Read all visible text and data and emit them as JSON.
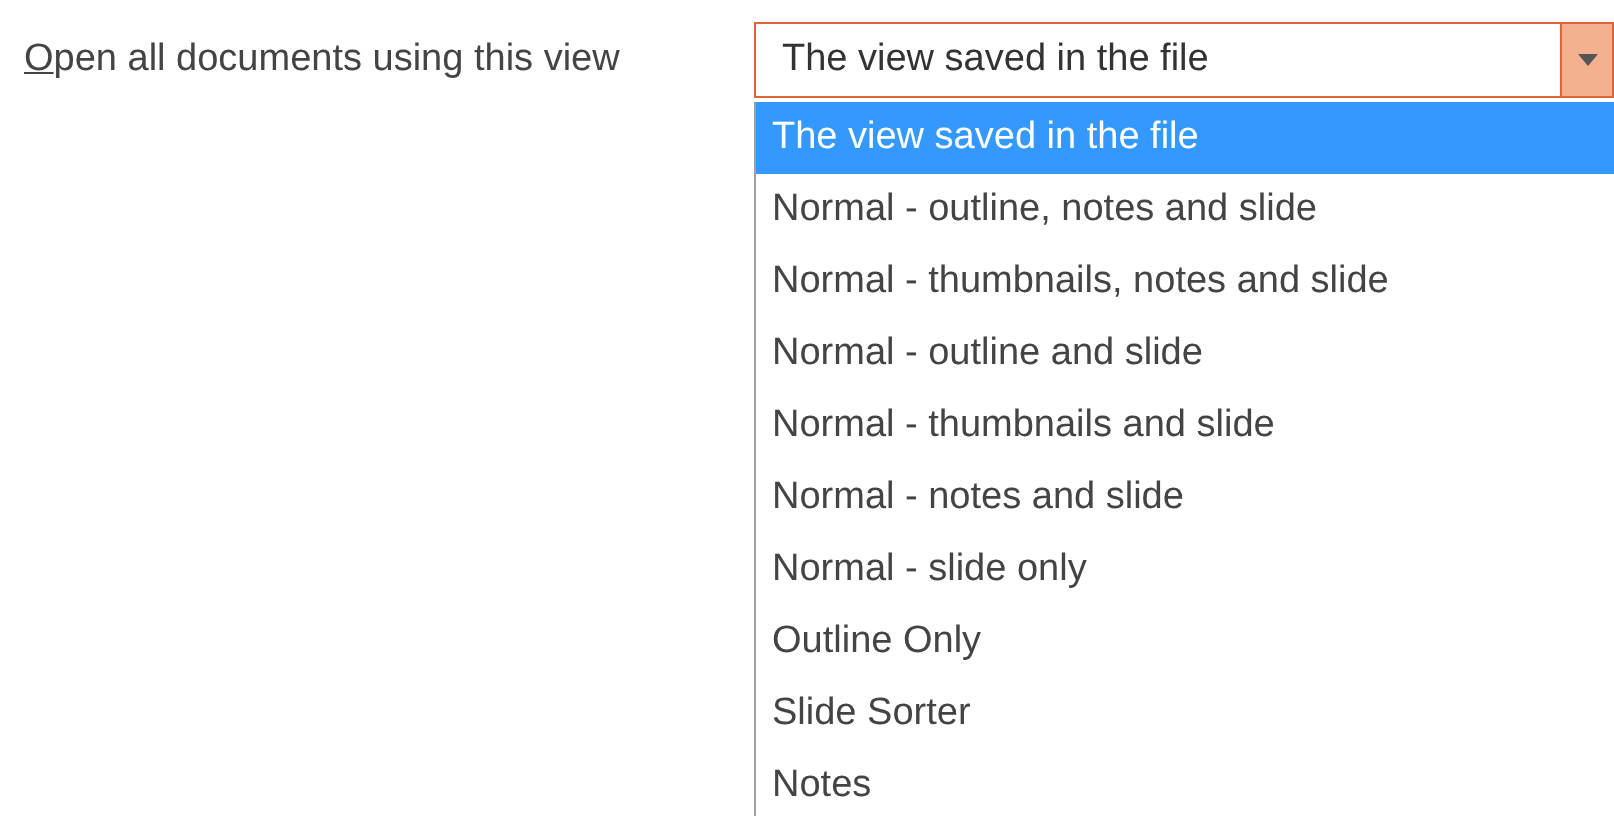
{
  "label": {
    "text": "Open all documents using this view",
    "mnemonic_underlined": true
  },
  "combo": {
    "value": "The view saved in the file",
    "focused": true,
    "expanded": true
  },
  "options": [
    {
      "text": "The view saved in the file",
      "selected": true
    },
    {
      "text": "Normal - outline, notes and slide",
      "selected": false
    },
    {
      "text": "Normal - thumbnails, notes and slide",
      "selected": false
    },
    {
      "text": "Normal - outline and slide",
      "selected": false
    },
    {
      "text": "Normal - thumbnails and slide",
      "selected": false
    },
    {
      "text": "Normal - notes and slide",
      "selected": false
    },
    {
      "text": "Normal - slide only",
      "selected": false
    },
    {
      "text": "Outline Only",
      "selected": false
    },
    {
      "text": "Slide Sorter",
      "selected": false
    },
    {
      "text": "Notes",
      "selected": false
    }
  ]
}
